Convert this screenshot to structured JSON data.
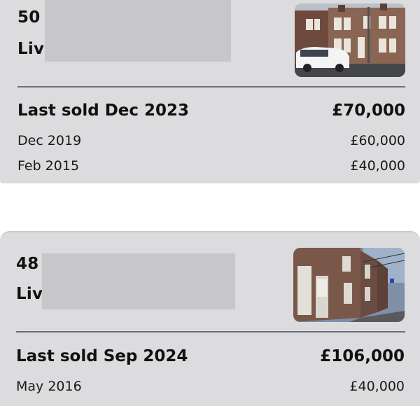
{
  "listings": [
    {
      "number": "50",
      "line2": "Liv",
      "last_sold_label": "Last sold Dec 2023",
      "last_sold_price": "£70,000",
      "history": [
        {
          "date": "Dec 2019",
          "price": "£60,000"
        },
        {
          "date": "Feb 2015",
          "price": "£40,000"
        }
      ]
    },
    {
      "number": "48",
      "line2": "Liv",
      "last_sold_label": "Last sold Sep 2024",
      "last_sold_price": "£106,000",
      "history": [
        {
          "date": "May 2016",
          "price": "£40,000"
        }
      ]
    }
  ]
}
